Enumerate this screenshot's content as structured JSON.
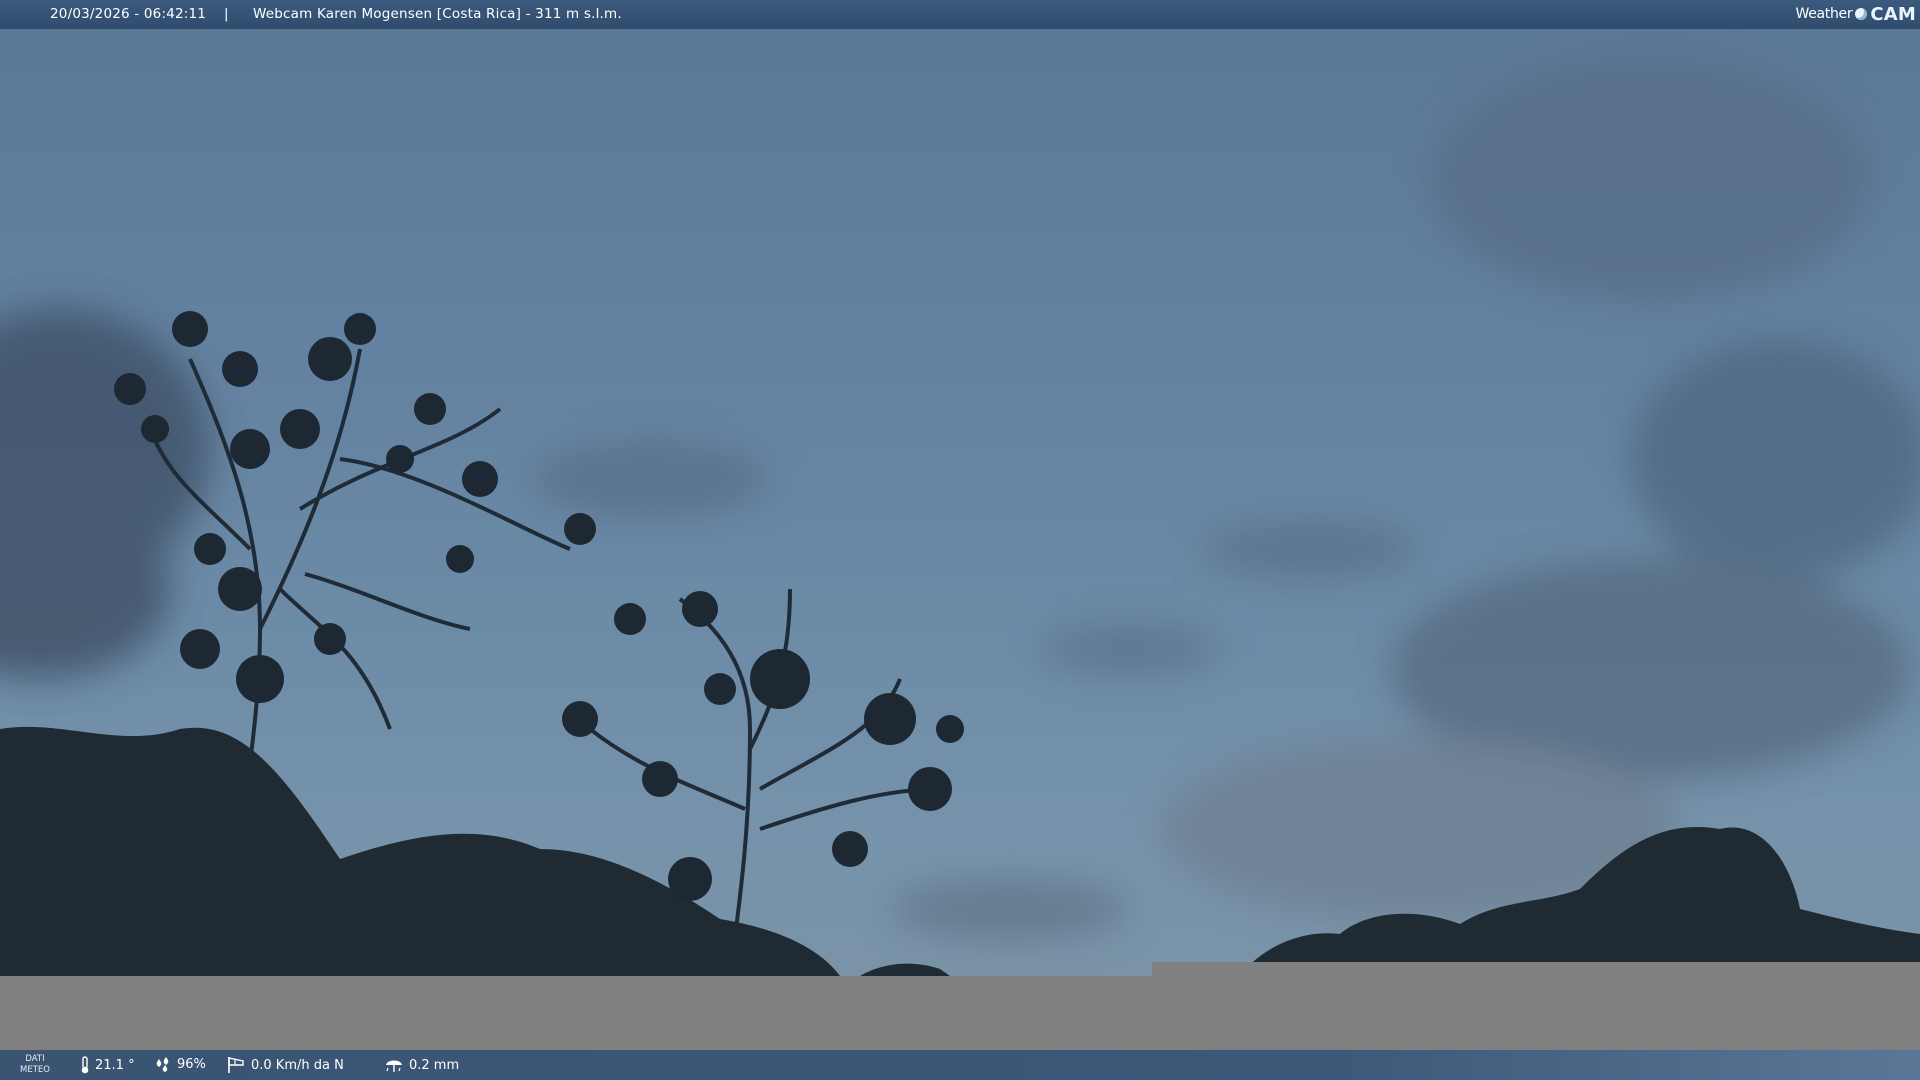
{
  "header": {
    "timestamp": "20/03/2026 - 06:42:11",
    "separator": "|",
    "webcam_title": "Webcam Karen Mogensen [Costa Rica]  - 311 m s.l.m.",
    "logo_weather": "Weather",
    "logo_cam": "CAM"
  },
  "weather": {
    "label_line1": "DATI",
    "label_line2": "METEO",
    "temperature": "21.1 °",
    "humidity": "96%",
    "wind": "0.0 Km/h da N",
    "rain": "0.2 mm",
    "icons": [
      "thermometer-icon",
      "humidity-drops-icon",
      "wind-windsock-icon",
      "rain-umbrella-icon"
    ]
  },
  "colors": {
    "top_bar": "#34527a",
    "bottom_bar": "#3a5472",
    "sky": "#6b8aa6",
    "gray_band": "#808080"
  }
}
